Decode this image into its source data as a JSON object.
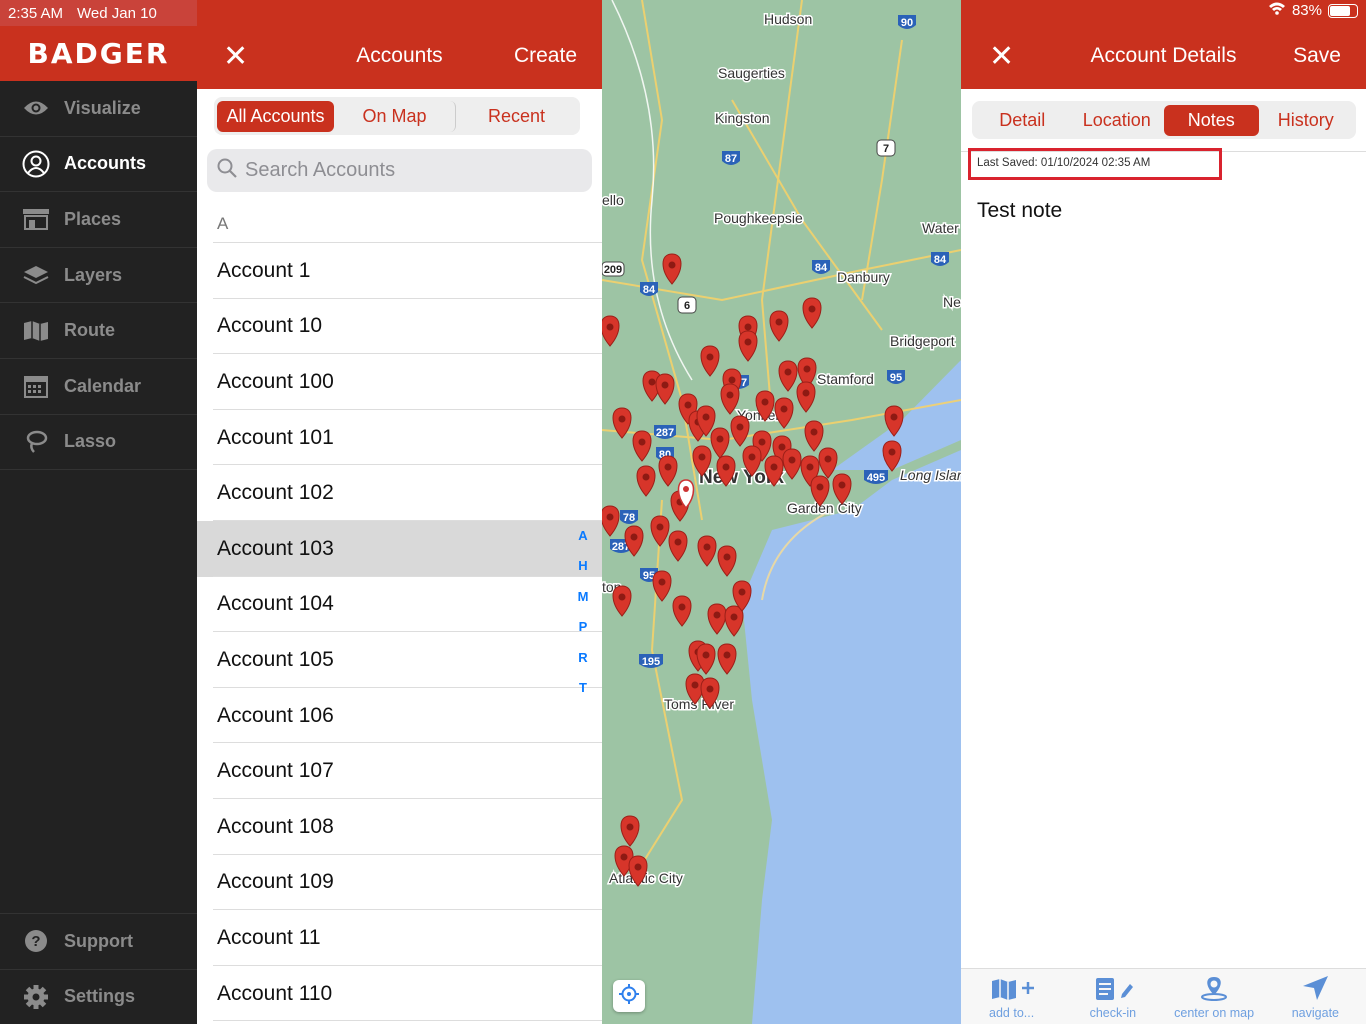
{
  "status": {
    "time": "2:35 AM",
    "date": "Wed Jan 10",
    "battery": "83%"
  },
  "brand": "BADGER",
  "sidebar": {
    "items": [
      {
        "label": "Visualize",
        "icon": "eye-icon"
      },
      {
        "label": "Accounts",
        "icon": "user-circle-icon"
      },
      {
        "label": "Places",
        "icon": "storefront-icon"
      },
      {
        "label": "Layers",
        "icon": "layers-icon"
      },
      {
        "label": "Route",
        "icon": "map-icon"
      },
      {
        "label": "Calendar",
        "icon": "calendar-icon"
      },
      {
        "label": "Lasso",
        "icon": "lasso-icon"
      }
    ],
    "bottom": [
      {
        "label": "Support",
        "icon": "help-icon"
      },
      {
        "label": "Settings",
        "icon": "gear-icon"
      }
    ]
  },
  "accounts": {
    "title": "Accounts",
    "create": "Create",
    "segments": [
      "All Accounts",
      "On Map",
      "Recent"
    ],
    "search_placeholder": "Search Accounts",
    "section": "A",
    "rows": [
      "Account 1",
      "Account 10",
      "Account 100",
      "Account 101",
      "Account 102",
      "Account 103",
      "Account 104",
      "Account 105",
      "Account 106",
      "Account 107",
      "Account 108",
      "Account 109",
      "Account 11",
      "Account 110"
    ],
    "index": [
      "A",
      "H",
      "M",
      "P",
      "R",
      "T"
    ]
  },
  "map": {
    "labels": [
      "Hudson",
      "Saugerties",
      "Kingston",
      "ello",
      "Poughkeepsie",
      "Water",
      "Danbury",
      "Ne",
      "Bridgeport",
      "Stamford",
      "Yonkers",
      "New York",
      "Long Islan",
      "Garden City",
      "ton",
      "Toms River",
      "Atlantic City"
    ],
    "shields": [
      "90",
      "87",
      "7",
      "84",
      "84",
      "209",
      "84",
      "6",
      "287",
      "95",
      "287",
      "80",
      "495",
      "78",
      "287",
      "95",
      "195"
    ]
  },
  "details": {
    "title": "Account Details",
    "save": "Save",
    "tabs": [
      "Detail",
      "Location",
      "Notes",
      "History"
    ],
    "last_saved": "Last Saved: 01/10/2024 02:35 AM",
    "note": "Test note",
    "toolbar": [
      "add to...",
      "check-in",
      "center on map",
      "navigate"
    ]
  }
}
